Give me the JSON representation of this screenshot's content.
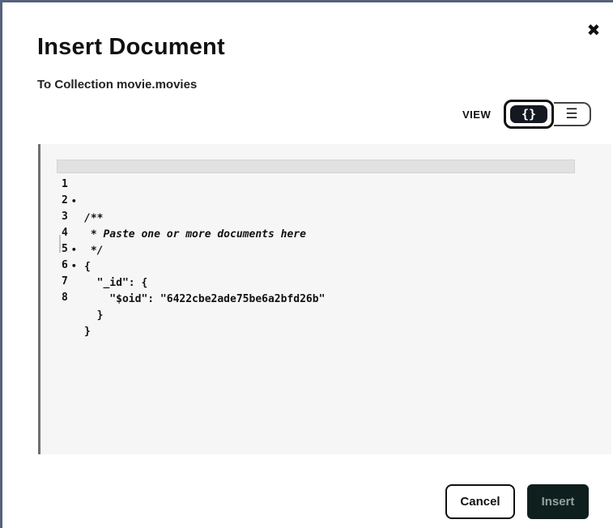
{
  "dialog": {
    "title": "Insert Document",
    "subtitle": "To Collection movie.movies",
    "close_glyph": "✖",
    "close_icon": "close-icon"
  },
  "view": {
    "label": "VIEW",
    "json_glyph": "{}",
    "json_icon": "curly-braces-icon",
    "list_glyph": "☰",
    "list_icon": "list-icon",
    "selected": "json"
  },
  "editor": {
    "lines": [
      {
        "num": "1",
        "fold": "•",
        "text": "/**"
      },
      {
        "num": "2",
        "fold": "",
        "text": " * Paste one or more documents here"
      },
      {
        "num": "3",
        "fold": "",
        "text": " */"
      },
      {
        "num": "4",
        "fold": "•",
        "text": "{"
      },
      {
        "num": "5",
        "fold": "•",
        "text": "  \"_id\": {"
      },
      {
        "num": "6",
        "fold": "",
        "text": "    \"$oid\": \"6422cbe2ade75be6a2bfd26b\""
      },
      {
        "num": "7",
        "fold": "",
        "text": "  }"
      },
      {
        "num": "8",
        "fold": "",
        "text": "}"
      }
    ]
  },
  "footer": {
    "cancel_label": "Cancel",
    "insert_label": "Insert"
  },
  "colors": {
    "insert_bg": "#0f1f1d",
    "toggle_active_bg": "#141820",
    "editor_bg": "#f6f6f6"
  }
}
